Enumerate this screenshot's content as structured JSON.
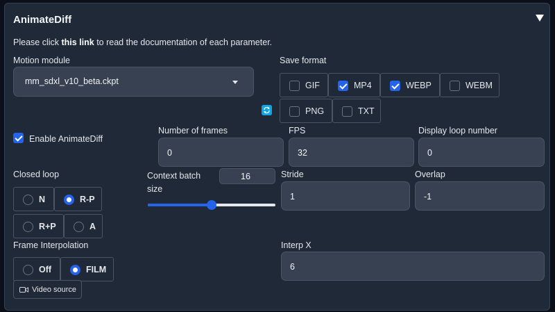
{
  "title": "AnimateDiff",
  "doc": {
    "prefix": "Please click ",
    "link": "this link",
    "suffix": " to read the documentation of each parameter."
  },
  "motion_module": {
    "label": "Motion module",
    "value": "mm_sdxl_v10_beta.ckpt"
  },
  "save_format": {
    "label": "Save format",
    "options": [
      {
        "label": "GIF",
        "checked": false
      },
      {
        "label": "MP4",
        "checked": true
      },
      {
        "label": "WEBP",
        "checked": true
      },
      {
        "label": "WEBM",
        "checked": false
      },
      {
        "label": "PNG",
        "checked": false
      },
      {
        "label": "TXT",
        "checked": false
      }
    ]
  },
  "enable": {
    "label": "Enable AnimateDiff",
    "checked": true
  },
  "number_of_frames": {
    "label": "Number of frames",
    "value": "0"
  },
  "fps": {
    "label": "FPS",
    "value": "32"
  },
  "display_loop": {
    "label": "Display loop number",
    "value": "0"
  },
  "closed_loop": {
    "label": "Closed loop",
    "options": [
      {
        "label": "N",
        "selected": false
      },
      {
        "label": "R-P",
        "selected": true
      },
      {
        "label": "R+P",
        "selected": false
      },
      {
        "label": "A",
        "selected": false
      }
    ]
  },
  "context_batch": {
    "label_line1": "Context batch",
    "label_line2": "size",
    "value": "16",
    "slider_fraction": 0.5
  },
  "stride": {
    "label": "Stride",
    "value": "1"
  },
  "overlap": {
    "label": "Overlap",
    "value": "-1"
  },
  "frame_interpolation": {
    "label": "Frame Interpolation",
    "options": [
      {
        "label": "Off",
        "selected": false
      },
      {
        "label": "FILM",
        "selected": true
      }
    ]
  },
  "interp_x": {
    "label": "Interp X",
    "value": "6"
  },
  "video_source": {
    "label": "Video source"
  },
  "colors": {
    "accent": "#2563eb",
    "panel": "#1f2937",
    "input": "#374151"
  }
}
